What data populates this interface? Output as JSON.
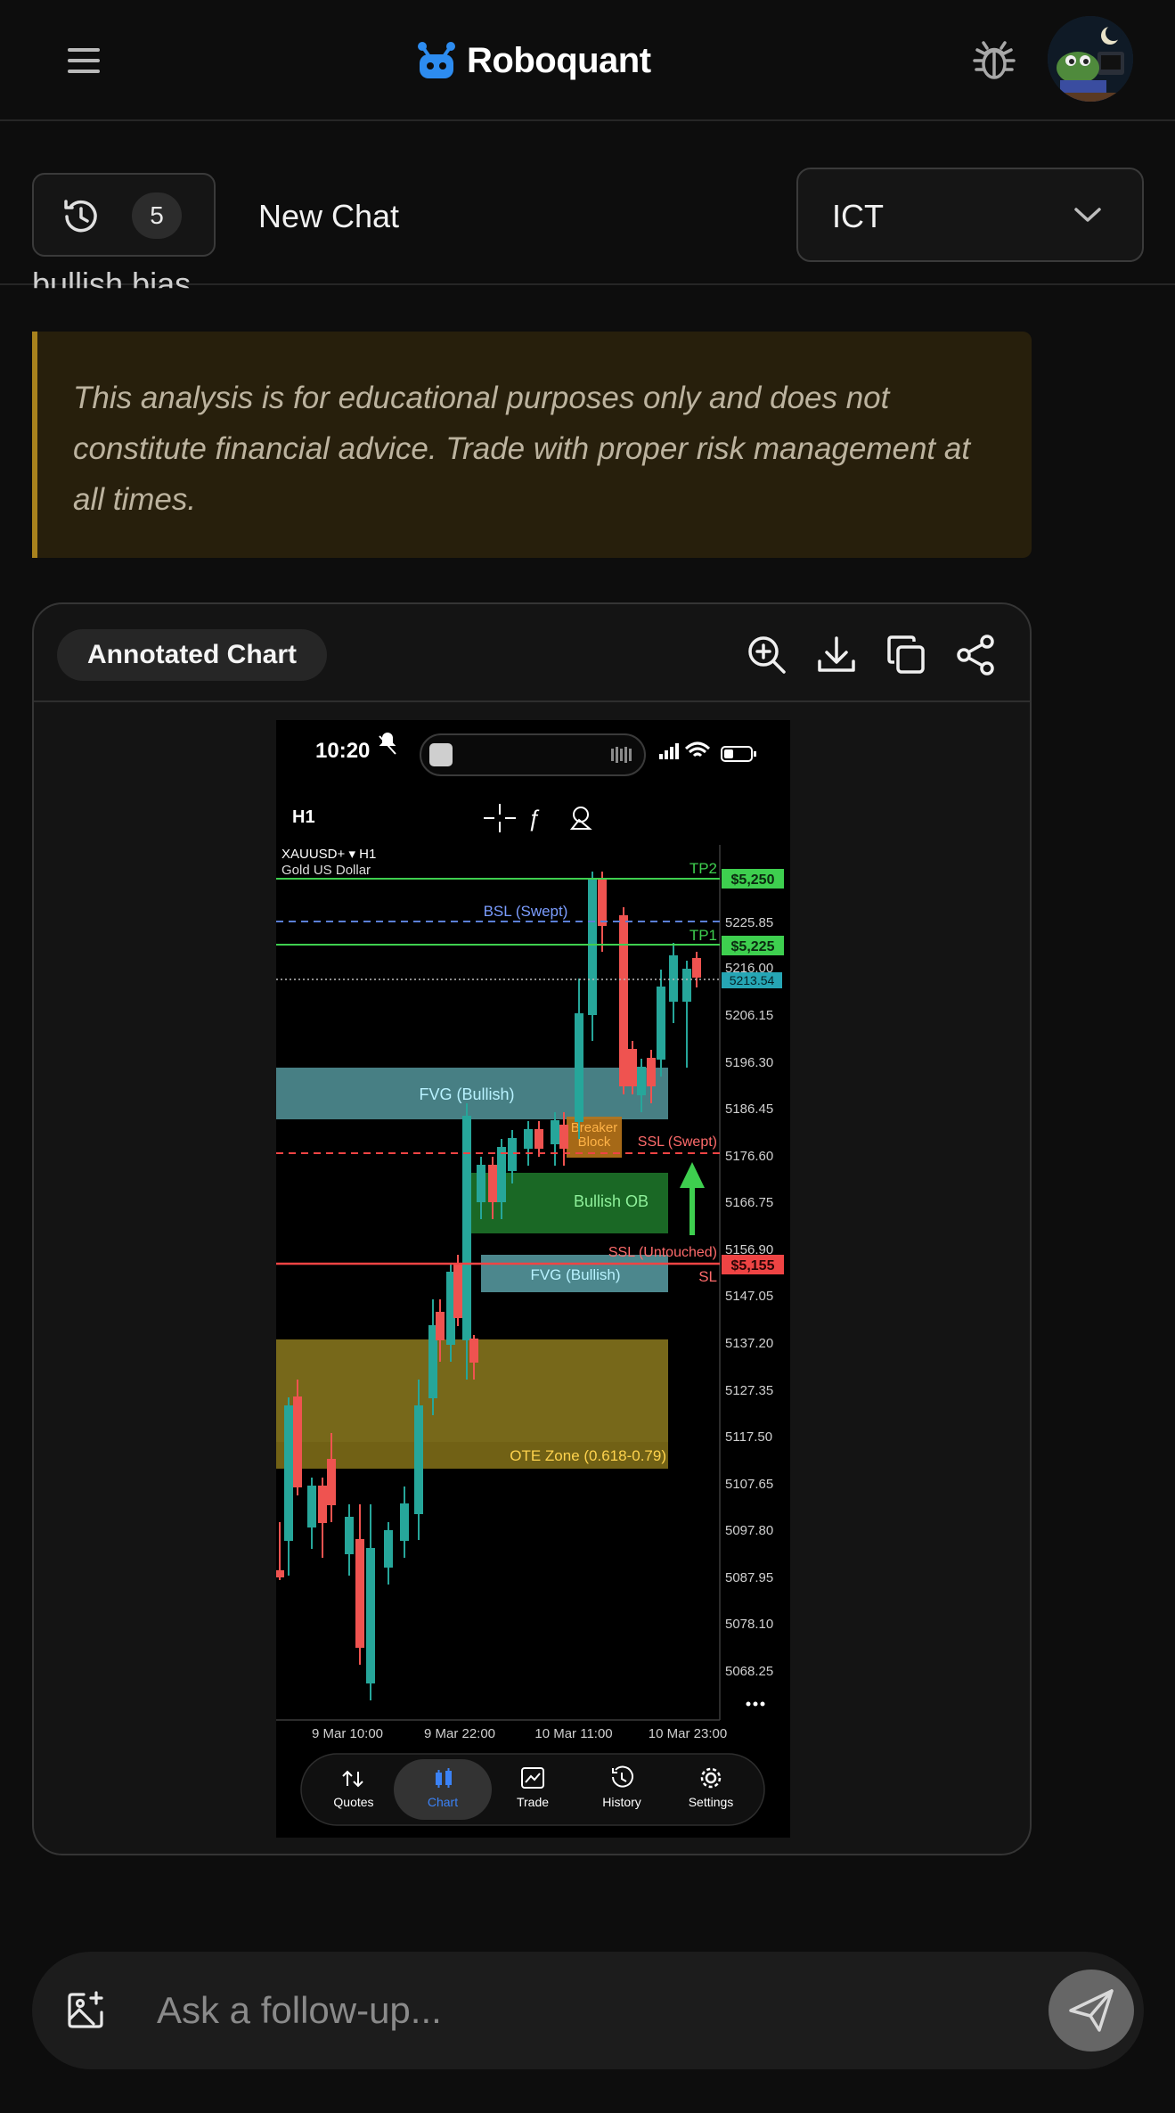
{
  "header": {
    "brand": "Roboquant",
    "icons": [
      "menu-icon",
      "robot-logo-icon",
      "bug-icon",
      "user-avatar"
    ]
  },
  "chat": {
    "history_count": "5",
    "title": "New Chat",
    "strategy_selected": "ICT"
  },
  "content": {
    "clipped_text": "bullish bias.",
    "disclaimer": "This analysis is for educational purposes only and does not constitute financial advice. Trade with proper risk management at all times."
  },
  "chart_card": {
    "label": "Annotated Chart",
    "actions": [
      "zoom-in-icon",
      "download-icon",
      "copy-icon",
      "share-icon"
    ]
  },
  "embedded_screenshot": {
    "status_time": "10:20",
    "timeframe": "H1",
    "symbol": "XAUUSD+ ▾ H1",
    "symbol_name": "Gold US Dollar",
    "price_axis": [
      "5225.85",
      "5216.00",
      "5206.15",
      "5196.30",
      "5186.45",
      "5176.60",
      "5166.75",
      "5156.90",
      "5147.05",
      "5137.20",
      "5127.35",
      "5117.50",
      "5107.65",
      "5097.80",
      "5087.95",
      "5078.10",
      "5068.25"
    ],
    "time_axis": [
      "9 Mar 10:00",
      "9 Mar 22:00",
      "10 Mar 11:00",
      "10 Mar 23:00"
    ],
    "price_tags": {
      "tp2": "$5,250",
      "tp1": "$5,225",
      "current": "5213.54",
      "sl": "$5,155"
    },
    "line_labels": {
      "tp2": "TP2",
      "tp1": "TP1",
      "bsl": "BSL (Swept)",
      "ssl_swept": "SSL (Swept)",
      "ssl_untouched": "SSL (Untouched)",
      "sl": "SL"
    },
    "zones": {
      "fvg_top": "FVG (Bullish)",
      "fvg_bottom": "FVG (Bullish)",
      "breaker": "Breaker Block",
      "bullish_ob": "Bullish OB",
      "ote": "OTE Zone (0.618-0.79)"
    },
    "nav": [
      {
        "label": "Quotes",
        "icon": "quotes-icon"
      },
      {
        "label": "Chart",
        "icon": "chart-icon"
      },
      {
        "label": "Trade",
        "icon": "trade-icon"
      },
      {
        "label": "History",
        "icon": "history-icon"
      },
      {
        "label": "Settings",
        "icon": "settings-icon"
      }
    ],
    "nav_active": "Chart",
    "accent": "#3b82f6",
    "colors": {
      "up": "#26a69a",
      "down": "#ef5350",
      "tp": "#3ecf4f",
      "sl": "#ef4444",
      "fvg": "#5fa9b0",
      "ote": "#8c7a1e"
    }
  },
  "composer": {
    "placeholder": "Ask a follow-up..."
  }
}
